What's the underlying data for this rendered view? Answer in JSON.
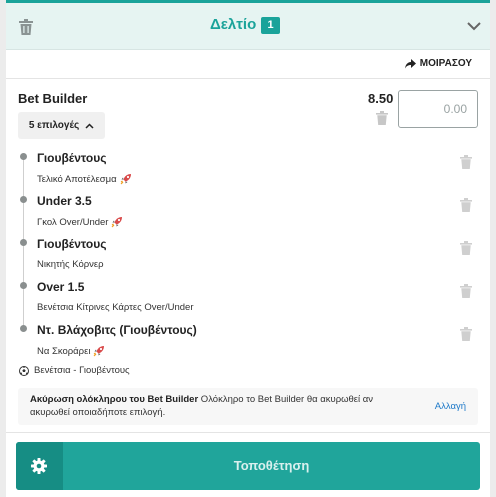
{
  "header": {
    "title": "Δελτίο",
    "count": "1"
  },
  "share_label": "ΜΟΙΡΑΣΟΥ",
  "bet_builder": {
    "title": "Bet Builder",
    "odds": "8.50",
    "stake_placeholder": "0.00",
    "selections_label": "5 επιλογές"
  },
  "legs": [
    {
      "name": "Γιουβέντους",
      "market": "Τελικό Αποτέλεσμα",
      "rocket": true
    },
    {
      "name": "Under 3.5",
      "market": "Γκολ Over/Under",
      "rocket": true
    },
    {
      "name": "Γιουβέντους",
      "market": "Νικητής Κόρνερ",
      "rocket": false
    },
    {
      "name": "Over 1.5",
      "market": "Βενέτσια Κίτρινες Κάρτες Over/Under",
      "rocket": false
    },
    {
      "name": "Ντ. Βλάχοβιτς (Γιουβέντους)",
      "market": "Να Σκοράρει",
      "rocket": true
    }
  ],
  "event": "Βενέτσια - Γιουβέντους",
  "notice": {
    "bold": "Ακύρωση ολόκληρου του Bet Builder",
    "text": " Ολόκληρο το Bet Builder θα ακυρωθεί αν ακυρωθεί οποιαδήποτε επιλογή.",
    "action": "Αλλαγή"
  },
  "place_button": "Τοποθέτηση",
  "colors": {
    "accent": "#1aa39a",
    "button": "#20a59b",
    "link": "#1f7ac9"
  },
  "icons": [
    "trash-icon",
    "chevron-down-icon",
    "share-arrow-icon",
    "chevron-up-icon",
    "rocket-icon",
    "football-icon",
    "gear-icon"
  ]
}
